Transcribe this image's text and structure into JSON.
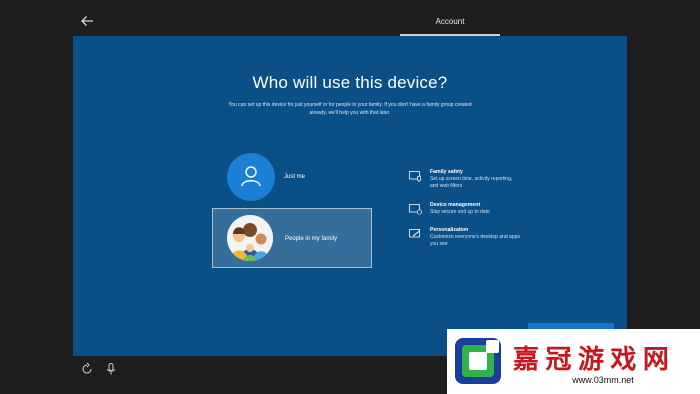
{
  "header": {
    "title": "Account",
    "back_icon": "arrow-left-icon"
  },
  "main": {
    "heading": "Who will use this device?",
    "subtext": "You can set up this device for just yourself or for people in your family. If you don't have a family group created already, we'll help you with that later.",
    "options": [
      {
        "label": "Just me",
        "icon": "person-icon",
        "selected": false
      },
      {
        "label": "People in my family",
        "icon": "family-avatar-icon",
        "selected": true
      }
    ],
    "features": [
      {
        "title": "Family safety",
        "desc": "Set up screen time, activity reporting, and web filters",
        "icon": "family-safety-icon"
      },
      {
        "title": "Device management",
        "desc": "Stay secure and up to date",
        "icon": "device-management-icon"
      },
      {
        "title": "Personalization",
        "desc": "Customize everyone's desktop and apps you see",
        "icon": "personalization-icon"
      }
    ]
  },
  "footer": {
    "icons": [
      "ease-of-access-icon",
      "microphone-icon"
    ]
  },
  "watermark": {
    "chars": [
      "嘉",
      "冠",
      "游",
      "戏",
      "网"
    ],
    "url": "www.03mm.net"
  },
  "colors": {
    "panel": "#0a4f86",
    "frame": "#1e1e1e",
    "accent": "#1c7fd6",
    "watermark_red": "#c8161d"
  }
}
